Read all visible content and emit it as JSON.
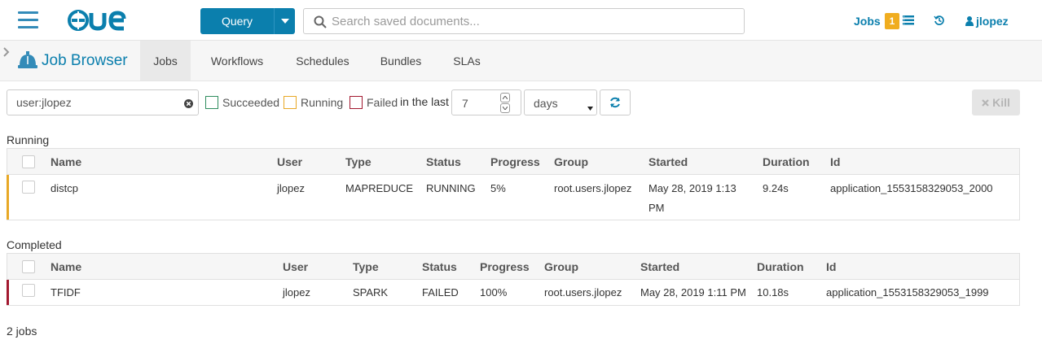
{
  "topbar": {
    "query_label": "Query",
    "search_placeholder": "Search saved documents...",
    "jobs_label": "Jobs",
    "jobs_count": "1",
    "user": "jlopez"
  },
  "subnav": {
    "app_title": "Job Browser",
    "tabs": [
      "Jobs",
      "Workflows",
      "Schedules",
      "Bundles",
      "SLAs"
    ],
    "active_tab": "Jobs"
  },
  "filters": {
    "text_value": "user:jlopez",
    "succeeded_label": "Succeeded",
    "running_label": "Running",
    "failed_label": "Failed",
    "in_last_label": "in the last",
    "days_value": "7",
    "days_unit": "days",
    "kill_label": "Kill"
  },
  "colors": {
    "succeeded": "#2f8d5e",
    "running": "#e8a825",
    "failed": "#a2182f",
    "accent": "#0b7fad"
  },
  "columns": [
    "Name",
    "User",
    "Type",
    "Status",
    "Progress",
    "Group",
    "Started",
    "Duration",
    "Id"
  ],
  "running": {
    "title": "Running",
    "rows": [
      {
        "name": "distcp",
        "user": "jlopez",
        "type": "MAPREDUCE",
        "status": "RUNNING",
        "progress": "5%",
        "group": "root.users.jlopez",
        "started_line1": "May 28, 2019 1:13",
        "started_line2": "PM",
        "duration": "9.24s",
        "id": "application_1553158329053_2000"
      }
    ]
  },
  "completed": {
    "title": "Completed",
    "rows": [
      {
        "name": "TFIDF",
        "user": "jlopez",
        "type": "SPARK",
        "status": "FAILED",
        "progress": "100%",
        "group": "root.users.jlopez",
        "started": "May 28, 2019 1:11 PM",
        "duration": "10.18s",
        "id": "application_1553158329053_1999"
      }
    ]
  },
  "footer": {
    "count": "2 jobs"
  }
}
